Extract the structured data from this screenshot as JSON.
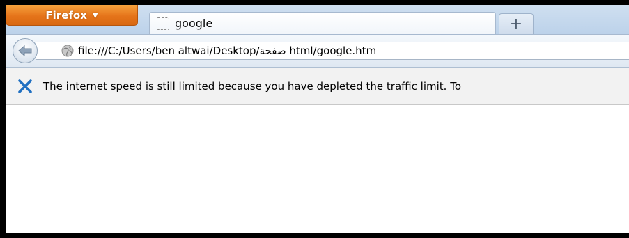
{
  "browser": {
    "menu_button_label": "Firefox",
    "menu_caret_icon": "caret-down-icon"
  },
  "tabs": [
    {
      "title": "google",
      "icon": "blank-page-icon",
      "active": true
    }
  ],
  "new_tab": {
    "label": "+",
    "icon": "plus-icon"
  },
  "navigation": {
    "back_icon": "back-arrow-icon",
    "site_icon": "globe-icon",
    "url": "file:///C:/Users/ben altwai/Desktop/صفحة html/google.htm"
  },
  "notification": {
    "close_icon": "close-x-icon",
    "message": "The internet speed is still limited because you have depleted the traffic limit. To"
  },
  "colors": {
    "firefox_button": "#e5741a",
    "close_x": "#1f6fc1",
    "frame_border": "#000000"
  }
}
